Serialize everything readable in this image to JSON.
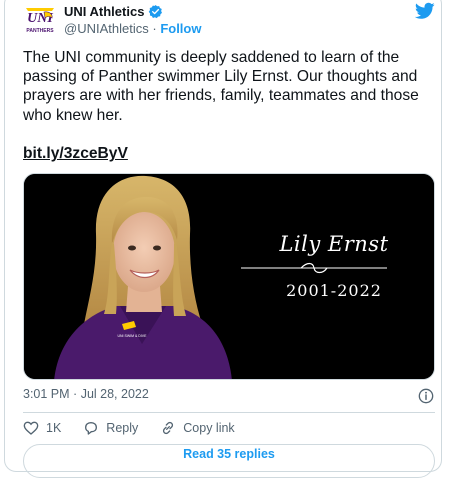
{
  "account": {
    "name": "UNI Athletics",
    "handle": "@UNIAthletics",
    "separator": "·",
    "follow_label": "Follow",
    "logo_text": "UNI",
    "logo_subtext": "PANTHERS"
  },
  "tweet": {
    "text": "The UNI community is deeply saddened to learn of the passing of Panther swimmer Lily Ernst. Our thoughts and prayers are with her friends, family, teammates and those who knew her.",
    "link": "bit.ly/3zceByV"
  },
  "media": {
    "memorial_name": "Lily Ernst",
    "memorial_years": "2001-2022",
    "jersey_text": "UNI SWIM & DIVE",
    "background_color": "#000000"
  },
  "meta": {
    "time": "3:01 PM",
    "separator": "·",
    "date": "Jul 28, 2022"
  },
  "actions": {
    "like_count": "1K",
    "reply_label": "Reply",
    "copy_link_label": "Copy link"
  },
  "footer": {
    "read_replies_label": "Read 35 replies"
  },
  "colors": {
    "accent": "#1d9bf0",
    "text": "#0f1419",
    "muted": "#536471",
    "border": "#cfd9de",
    "uni_purple": "#4b116f",
    "uni_gold": "#ffcc00"
  }
}
